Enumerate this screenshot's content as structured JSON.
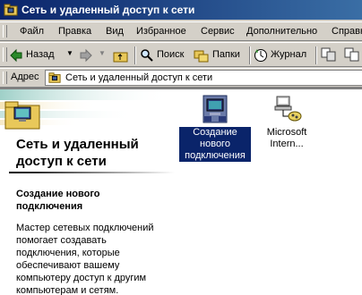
{
  "window": {
    "title": "Сеть и удаленный доступ к сети"
  },
  "menu": [
    "Файл",
    "Правка",
    "Вид",
    "Избранное",
    "Сервис",
    "Дополнительно",
    "Справка"
  ],
  "toolbar": {
    "back": "Назад",
    "search": "Поиск",
    "folders": "Папки",
    "history": "Журнал"
  },
  "address": {
    "label": "Адрес",
    "value": "Сеть и удаленный доступ к сети"
  },
  "left_pane": {
    "title": "Сеть и удаленный доступ к сети",
    "subtitle": "Создание нового подключения",
    "description": "Мастер сетевых подключений помогает создавать подключения, которые обеспечивают вашему компьютеру доступ к другим компьютерам и сетям."
  },
  "items": [
    {
      "label": "Создание нового подключения",
      "selected": true,
      "icon": "new-connection-icon"
    },
    {
      "label": "Microsoft Intern...",
      "selected": false,
      "icon": "network-connection-icon"
    }
  ],
  "colors": {
    "title_bar": "#0a246a",
    "selection": "#0a246a",
    "face": "#d4d0c8"
  }
}
